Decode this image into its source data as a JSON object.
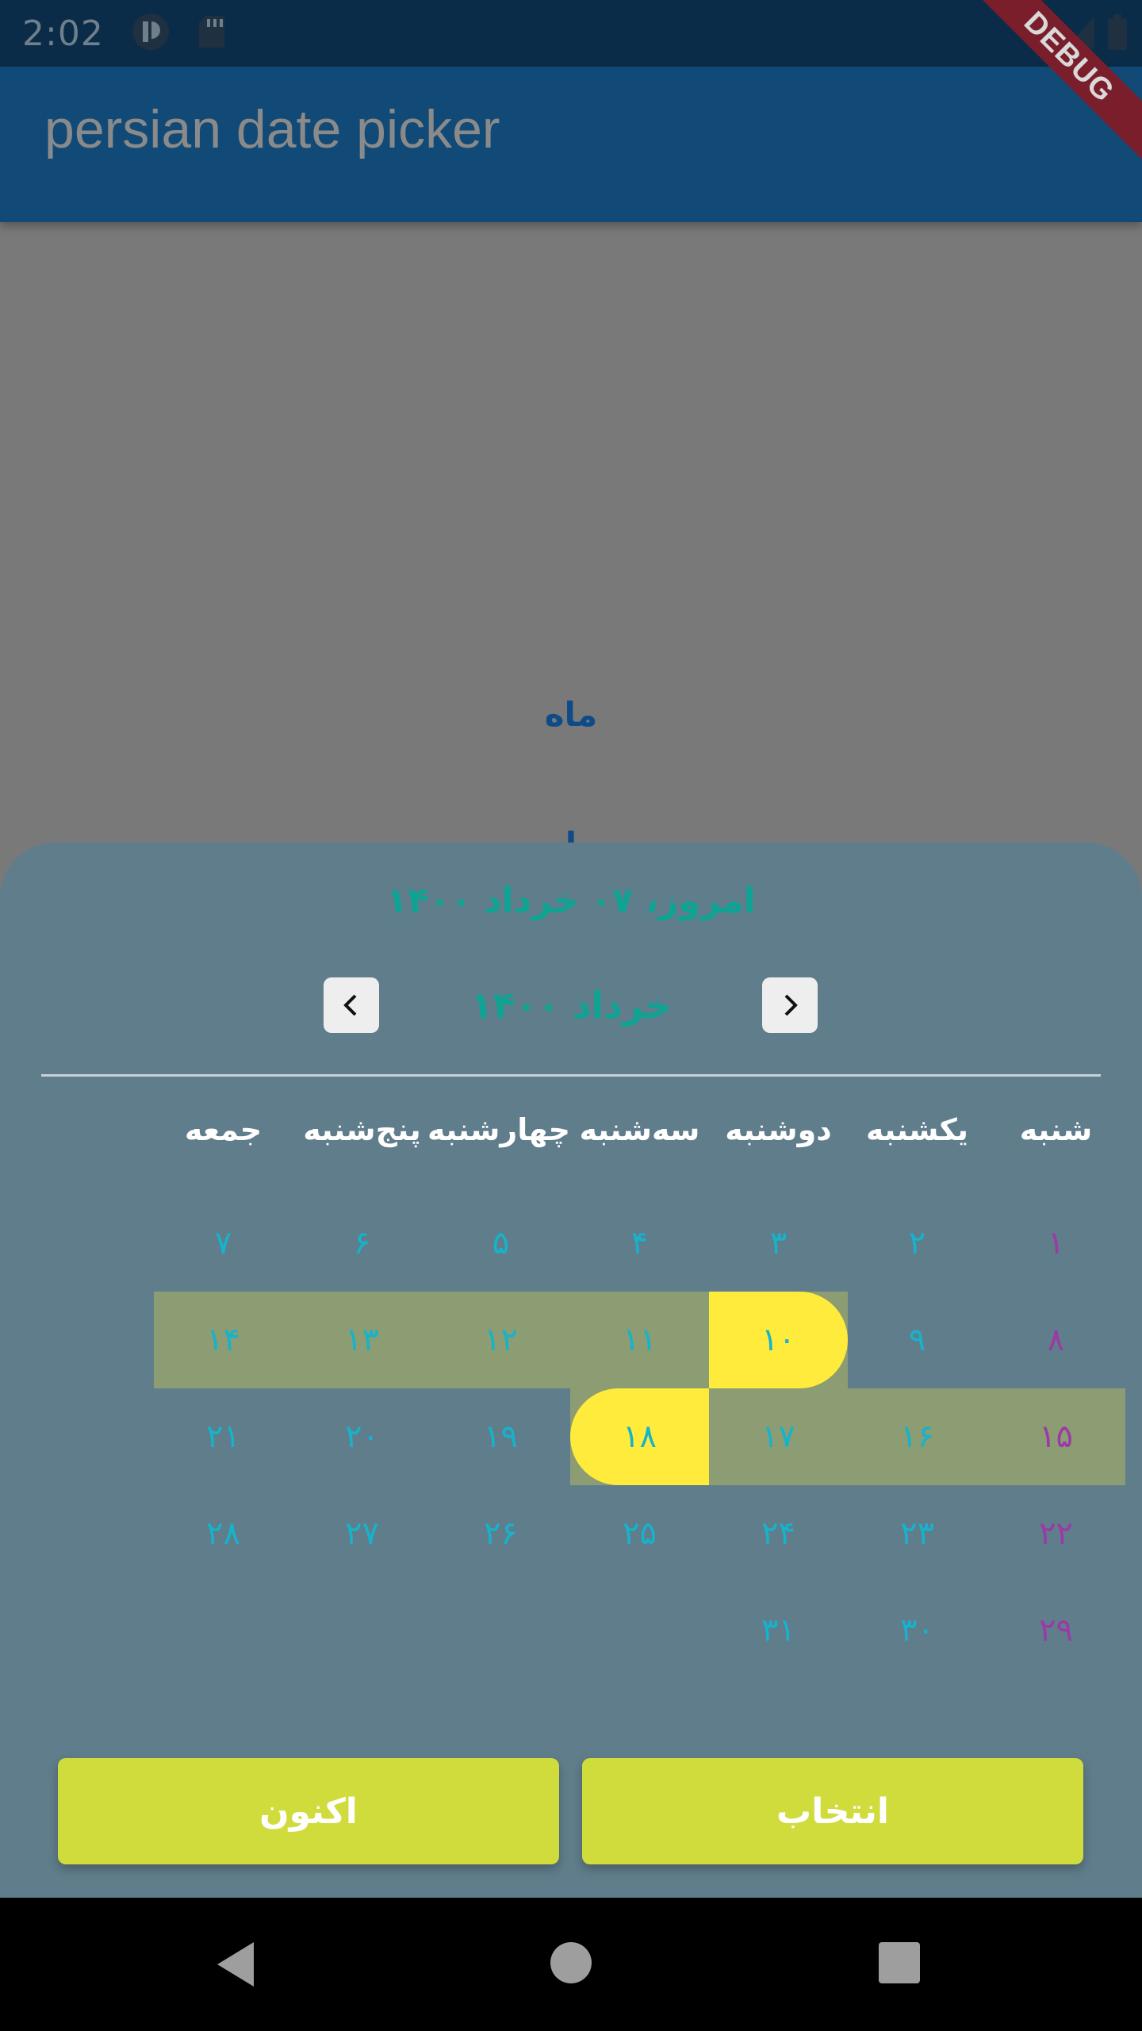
{
  "status_bar": {
    "time": "2:02",
    "icons": [
      "notification-icon",
      "sd-card-icon",
      "wifi-icon",
      "signal-icon",
      "battery-icon"
    ]
  },
  "app_bar": {
    "title": "persian date picker"
  },
  "debug_banner": "DEBUG",
  "background": {
    "month_label": "ماه",
    "partial_label": "ا"
  },
  "date_picker": {
    "today_label": "امروز، ۰۷ خرداد ۱۴۰۰",
    "month_title": "خرداد ۱۴۰۰",
    "weekdays": [
      "شنبه",
      "یکشنبه",
      "دوشنبه",
      "سه‌شنبه",
      "چهارشنبه",
      "پنج‌شنبه",
      "جمعه"
    ],
    "weeks": [
      [
        "۱",
        "۲",
        "۳",
        "۴",
        "۵",
        "۶",
        "۷"
      ],
      [
        "۸",
        "۹",
        "۱۰",
        "۱۱",
        "۱۲",
        "۱۳",
        "۱۴"
      ],
      [
        "۱۵",
        "۱۶",
        "۱۷",
        "۱۸",
        "۱۹",
        "۲۰",
        "۲۱"
      ],
      [
        "۲۲",
        "۲۳",
        "۲۴",
        "۲۵",
        "۲۶",
        "۲۷",
        "۲۸"
      ],
      [
        "۲۹",
        "۳۰",
        "۳۱",
        "",
        "",
        "",
        ""
      ]
    ],
    "range_start": "۱۰",
    "range_end": "۱۸",
    "colors": {
      "sheet": "#607d8b",
      "day_text": "#15b3cc",
      "weekend_text": "#9b3aa6",
      "range_band": "#8c9c73",
      "range_endpoint": "#ffeb3b",
      "title_text": "#0fa393",
      "button": "#d0dc3c"
    },
    "buttons": {
      "select": "انتخاب",
      "now": "اکنون"
    }
  },
  "nav_bar": {
    "icons": [
      "back-icon",
      "home-icon",
      "recents-icon"
    ]
  }
}
